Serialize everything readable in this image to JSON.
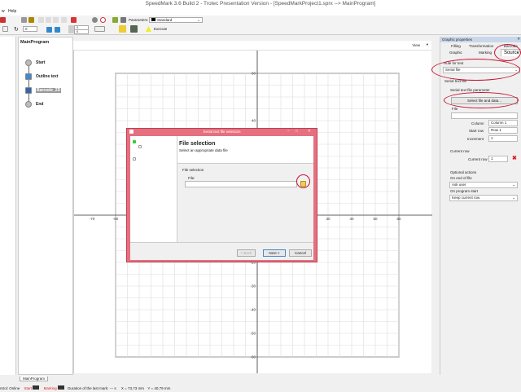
{
  "window": {
    "title": "SpeedMark 3.6 Build 2 - Trotec Presentation Version - [SpeedMarkProject1.sprx --> MainProgram]"
  },
  "menu": {
    "items": [
      "w",
      "Help"
    ]
  },
  "toolbar": {
    "parameters_label": "Parameters:",
    "parameters_value": "Standard",
    "rotate_value": "0",
    "offset_x": "0",
    "offset_y": "0",
    "execute_label": "Execute"
  },
  "program": {
    "title": "MainProgram",
    "nodes": [
      "Start",
      "Outline text",
      "Barcode_2D",
      "End"
    ],
    "tab": "MainProgram"
  },
  "canvas": {
    "view_label": "View",
    "x_ticks": [
      -70,
      -60,
      30,
      40,
      50,
      60
    ],
    "y_ticks": [
      60,
      40,
      -20,
      -30,
      -40,
      -50,
      -60
    ],
    "x_range": [
      -78,
      74
    ],
    "y_range": [
      66,
      -66
    ]
  },
  "panel": {
    "title": "Graphic properties",
    "tabs_row1": [
      "Filling",
      "Transformation",
      "Barcode"
    ],
    "tabs_row2": [
      "Graphic",
      "Marking",
      "Source"
    ],
    "rule_label": "Rule for text",
    "rule_value": "Serial file",
    "section": "Serial text file",
    "param_label": "Serial text file parameter",
    "select_button": "Select file and data...",
    "file_label": "File",
    "file_value": "",
    "column_label": "Column",
    "column_value": "Column 1",
    "start_row_label": "Start row",
    "start_row_value": "Row 1",
    "increment_label": "Increment",
    "increment_value": "1",
    "current_row_section": "Current row",
    "current_row_label": "Current row",
    "current_row_value": "1",
    "optional_label": "Optional actions",
    "end_of_file_label": "On end of file",
    "end_of_file_value": "Ask user",
    "program_start_label": "On program start",
    "program_start_value": "Keep current row"
  },
  "dialog": {
    "title": "Serial text file selection",
    "heading": "File selection",
    "subheading": "Select an appropriate data file",
    "group": "File selection",
    "file_label": "File:",
    "file_value": "",
    "back": "< Back",
    "next": "Next >",
    "cancel": "Cancel"
  },
  "status": {
    "control": "ntrol: Online",
    "start": "Start",
    "marking": "Marking",
    "duration": "Duration of the last mark: --- s",
    "x": "X = 73,73 mm",
    "y": "Y = 40,79 mm"
  }
}
